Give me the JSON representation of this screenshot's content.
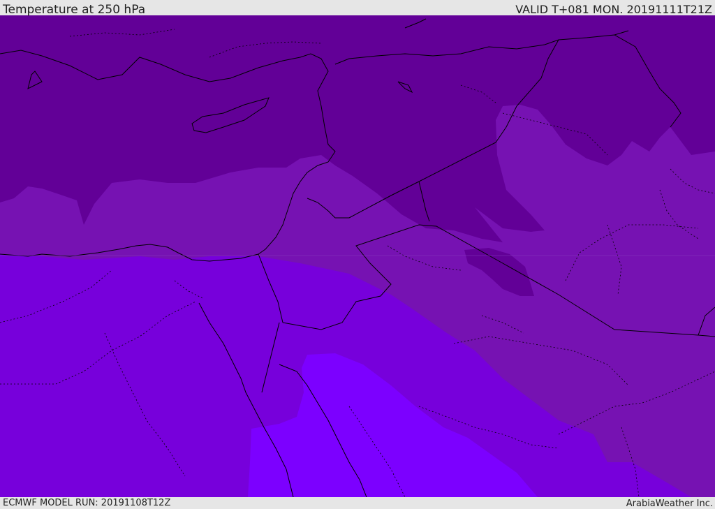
{
  "header": {
    "title": "Temperature at 250 hPa",
    "valid_time": "VALID T+081 MON. 20191111T21Z"
  },
  "footer": {
    "model_run": "ECMWF MODEL RUN: 20191108T12Z",
    "credit": "ArabiaWeather Inc."
  },
  "map": {
    "region": "Eastern Mediterranean and Middle East",
    "colors": {
      "band_coldest": "#620097",
      "band_cold": "#7612b2",
      "band_mid": "#7700db",
      "band_warm": "#7c00ff",
      "coastline": "#000000",
      "borders": "#000000"
    }
  }
}
